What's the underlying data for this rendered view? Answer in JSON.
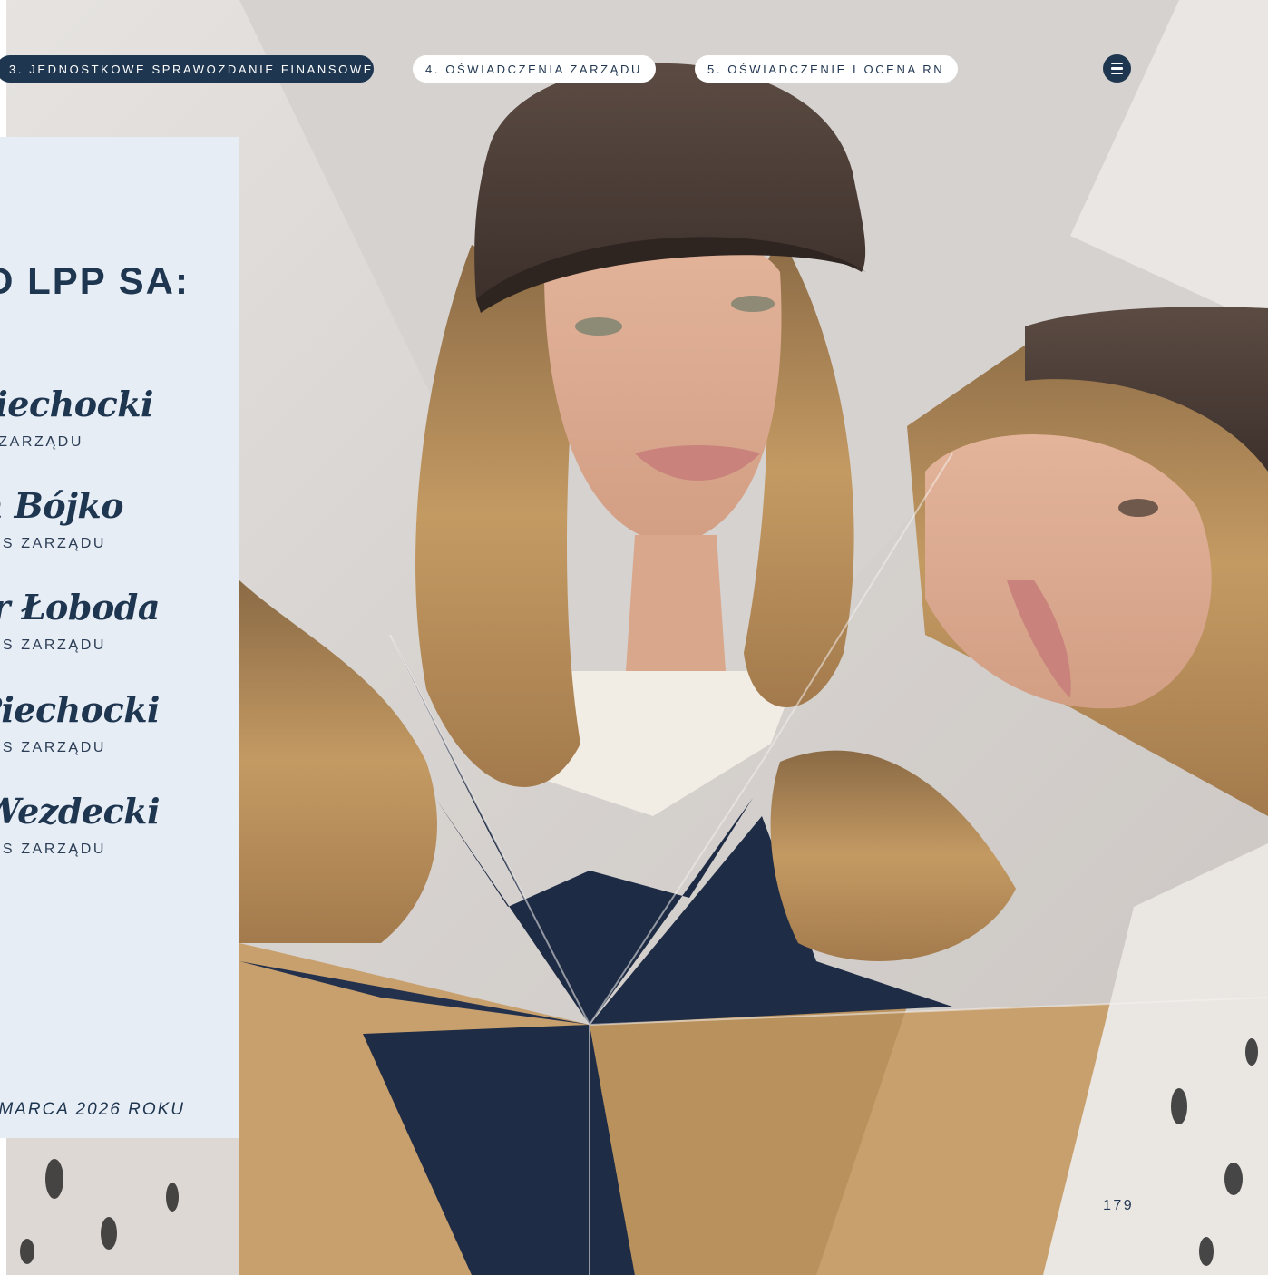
{
  "nav": {
    "items": [
      {
        "label": "3. JEDNOSTKOWE SPRAWOZDANIE FINANSOWE",
        "active": true
      },
      {
        "label": "4. OŚWIADCZENIA ZARZĄDU",
        "active": false
      },
      {
        "label": "5. OŚWIADCZENIE I OCENA RN",
        "active": false
      }
    ],
    "menu_icon": "hamburger-menu-icon"
  },
  "panel": {
    "heading": "D LPP SA:",
    "signers": [
      {
        "name": "Piechocki",
        "role": "ZARZĄDU"
      },
      {
        "name": "n Bójko",
        "role": "ES ZARZĄDU"
      },
      {
        "name": "r Łoboda",
        "role": "ES ZARZĄDU"
      },
      {
        "name": "Piechocki",
        "role": "ES ZARZĄDU"
      },
      {
        "name": "Wezdecki",
        "role": "ES ZARZĄDU"
      }
    ],
    "date": "MARCA 2026 ROKU"
  },
  "page_number": "179",
  "colors": {
    "navy": "#1f3650",
    "panel_bg": "#e7edf5",
    "white": "#ffffff"
  }
}
